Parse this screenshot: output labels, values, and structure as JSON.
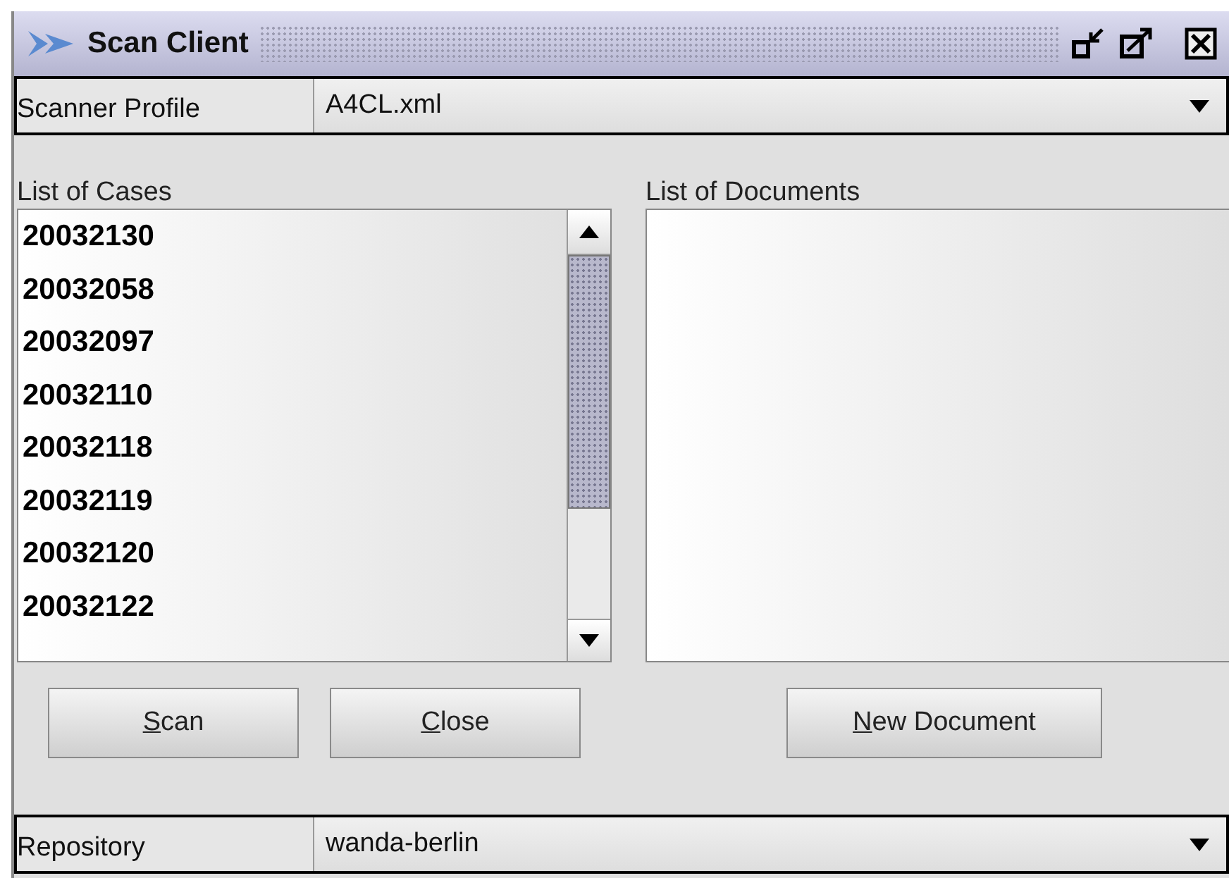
{
  "window": {
    "title": "Scan Client"
  },
  "profile": {
    "label": "Scanner Profile",
    "value": "A4CL.xml"
  },
  "cases": {
    "label": "List of Cases",
    "items": [
      "20032130",
      "20032058",
      "20032097",
      "20032110",
      "20032118",
      "20032119",
      "20032120",
      "20032122"
    ]
  },
  "documents": {
    "label": "List of Documents"
  },
  "buttons_left": [
    "Scan",
    "Close"
  ],
  "buttons_right": [
    "New Document"
  ],
  "repository": {
    "label": "Repository",
    "value": "wanda-berlin"
  }
}
